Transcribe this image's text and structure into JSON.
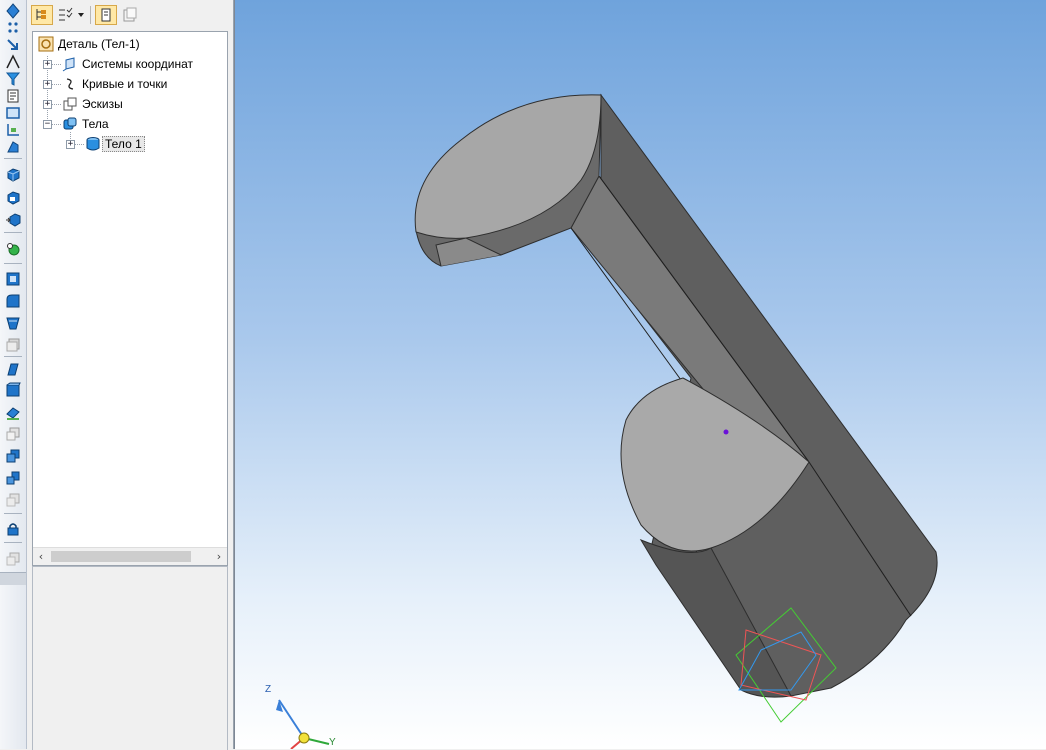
{
  "tree": {
    "root_label": "Деталь (Тел-1)",
    "items": [
      {
        "label": "Системы координат",
        "expander": "+"
      },
      {
        "label": "Кривые и точки",
        "expander": "+"
      },
      {
        "label": "Эскизы",
        "expander": "+"
      },
      {
        "label": "Тела",
        "expander": "−"
      },
      {
        "label": "Тело 1",
        "expander": "+"
      }
    ]
  },
  "axes": {
    "z": "Z",
    "y": "Y"
  },
  "icons": {
    "toolbar": [
      "vertex-icon",
      "dotted-points-icon",
      "arrow-point-icon",
      "angle-icon",
      "filter-icon",
      "document-icon",
      "rectangle-icon",
      "axis-plane-icon",
      "sketch-hand-icon",
      "extrude-icon",
      "rotate-icon",
      "cut-icon",
      "boolean-icon",
      "shell-icon",
      "fillet-icon",
      "draft-icon",
      "offset-icon",
      "surface-icon",
      "box-icon",
      "plane-icon",
      "copy-icon",
      "array-icon",
      "mirror-icon",
      "lock-icon",
      "properties-icon"
    ],
    "tree_toolbar": [
      "tree-view-icon",
      "tree-filter-icon",
      "dropdown-arrow-icon",
      "panel-icon",
      "properties-icon"
    ]
  },
  "colors": {
    "viewport_top": "#6fa3dc",
    "viewport_bottom": "#ffffff",
    "body_dark": "#5f5f5f",
    "face_light": "#a7a7a7"
  }
}
